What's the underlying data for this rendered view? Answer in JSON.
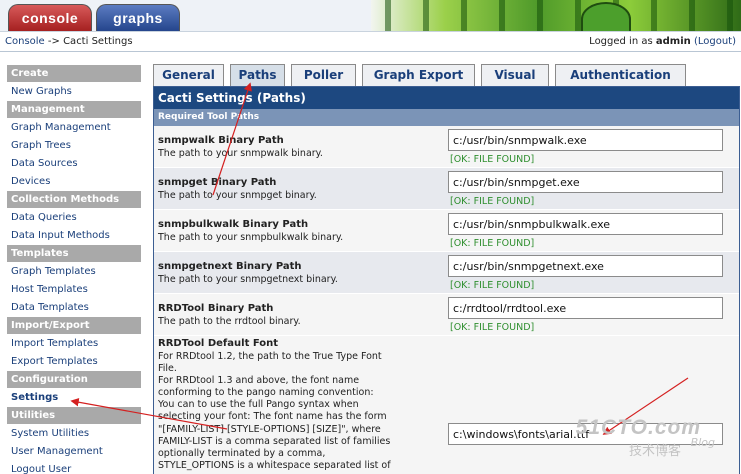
{
  "top_tabs": {
    "console": "console",
    "graphs": "graphs"
  },
  "breadcrumb": {
    "root": "Console",
    "separator": "->",
    "current": "Cacti Settings"
  },
  "login": {
    "prefix": "Logged in as",
    "user": "admin",
    "logout": "(Logout)"
  },
  "sidebar": [
    {
      "type": "head",
      "label": "Create"
    },
    {
      "type": "item",
      "label": "New Graphs"
    },
    {
      "type": "head",
      "label": "Management"
    },
    {
      "type": "item",
      "label": "Graph Management"
    },
    {
      "type": "item",
      "label": "Graph Trees"
    },
    {
      "type": "item",
      "label": "Data Sources"
    },
    {
      "type": "item",
      "label": "Devices"
    },
    {
      "type": "head",
      "label": "Collection Methods"
    },
    {
      "type": "item",
      "label": "Data Queries"
    },
    {
      "type": "item",
      "label": "Data Input Methods"
    },
    {
      "type": "head",
      "label": "Templates"
    },
    {
      "type": "item",
      "label": "Graph Templates"
    },
    {
      "type": "item",
      "label": "Host Templates"
    },
    {
      "type": "item",
      "label": "Data Templates"
    },
    {
      "type": "head",
      "label": "Import/Export"
    },
    {
      "type": "item",
      "label": "Import Templates"
    },
    {
      "type": "item",
      "label": "Export Templates"
    },
    {
      "type": "head",
      "label": "Configuration"
    },
    {
      "type": "item",
      "label": "Settings",
      "active": true
    },
    {
      "type": "head",
      "label": "Utilities"
    },
    {
      "type": "item",
      "label": "System Utilities"
    },
    {
      "type": "item",
      "label": "User Management"
    },
    {
      "type": "item",
      "label": "Logout User"
    }
  ],
  "settings_tabs": [
    {
      "label": "General"
    },
    {
      "label": "Paths",
      "active": true
    },
    {
      "label": "Poller"
    },
    {
      "label": "Graph Export"
    },
    {
      "label": "Visual"
    },
    {
      "label": "Authentication"
    }
  ],
  "panel": {
    "title": "Cacti Settings (Paths)",
    "subhead": "Required Tool Paths",
    "rows": [
      {
        "title": "snmpwalk Binary Path",
        "desc": "The path to your snmpwalk binary.",
        "value": "c:/usr/bin/snmpwalk.exe",
        "status": "[OK: FILE FOUND]"
      },
      {
        "title": "snmpget Binary Path",
        "desc": "The path to your snmpget binary.",
        "value": "c:/usr/bin/snmpget.exe",
        "status": "[OK: FILE FOUND]"
      },
      {
        "title": "snmpbulkwalk Binary Path",
        "desc": "The path to your snmpbulkwalk binary.",
        "value": "c:/usr/bin/snmpbulkwalk.exe",
        "status": "[OK: FILE FOUND]"
      },
      {
        "title": "snmpgetnext Binary Path",
        "desc": "The path to your snmpgetnext binary.",
        "value": "c:/usr/bin/snmpgetnext.exe",
        "status": "[OK: FILE FOUND]"
      },
      {
        "title": "RRDTool Binary Path",
        "desc": "The path to the rrdtool binary.",
        "value": "c:/rrdtool/rrdtool.exe",
        "status": "[OK: FILE FOUND]"
      }
    ],
    "font_row": {
      "title": "RRDTool Default Font",
      "desc": "For RRDtool 1.2, the path to the True Type Font\nFile.\nFor RRDtool 1.3 and above, the font name\nconforming to the pango naming convention:\nYou can to use the full Pango syntax when\nselecting your font: The font name has the form\n\"[FAMILY-LIST] [STYLE-OPTIONS] [SIZE]\", where\nFAMILY-LIST is a comma separated list of families\noptionally terminated by a comma,\nSTYLE_OPTIONS is a whitespace separated list of",
      "value": "c:\\windows\\fonts\\arial.ttf"
    }
  },
  "watermark": {
    "brand": "51CTO.com",
    "sub": "技术博客",
    "blog": "Blog"
  },
  "colors": {
    "annotation": "#d42020",
    "panel_title": "#1d4880",
    "ok_status": "#2f8f2f"
  },
  "icons": [
    "cactus-banner-art",
    "arrow-annotation"
  ]
}
